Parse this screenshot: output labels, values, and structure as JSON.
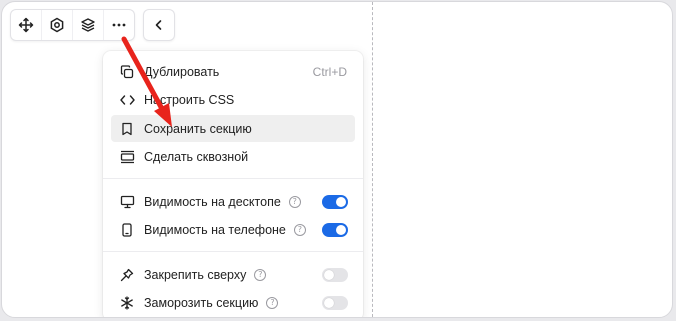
{
  "menu": {
    "items": [
      {
        "label": "Дублировать",
        "shortcut": "Ctrl+D"
      },
      {
        "label": "Настроить CSS"
      },
      {
        "label": "Сохранить секцию"
      },
      {
        "label": "Сделать сквозной"
      }
    ],
    "visibility": [
      {
        "label": "Видимость на десктопе",
        "on": true
      },
      {
        "label": "Видимость на телефоне",
        "on": true
      }
    ],
    "options": [
      {
        "label": "Закрепить сверху",
        "on": false
      },
      {
        "label": "Заморозить секцию",
        "on": false
      }
    ]
  },
  "help_glyph": "?",
  "colors": {
    "toggle_on": "#1b6ae6",
    "toggle_off": "#e4e4e7",
    "annotation_arrow": "#e8241c",
    "highlight": "#efefef"
  },
  "icons": [
    "move-icon",
    "settings-icon",
    "layers-icon",
    "more-icon",
    "chevron-left-icon",
    "duplicate-icon",
    "code-icon",
    "bookmark-icon",
    "layout-icon",
    "desktop-icon",
    "phone-icon",
    "pin-icon",
    "snowflake-icon"
  ]
}
